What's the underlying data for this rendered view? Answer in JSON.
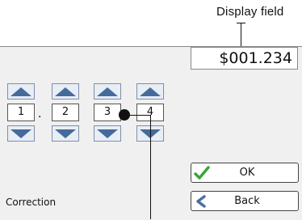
{
  "callout": {
    "label": "Display field"
  },
  "display": {
    "value": "$001.234"
  },
  "digits": [
    "1",
    "2",
    "3",
    "4"
  ],
  "separator": ".",
  "buttons": {
    "ok": "OK",
    "back": "Back"
  },
  "status": {
    "correction": "Correction"
  },
  "colors": {
    "arrow": "#456b9a",
    "check": "#3aa63a",
    "back_arrow": "#4a6fa0",
    "panel": "#f0f0f0"
  },
  "icons": {
    "up": "triangle-up-icon",
    "down": "triangle-down-icon",
    "ok": "checkmark-icon",
    "back": "back-arrow-icon"
  }
}
